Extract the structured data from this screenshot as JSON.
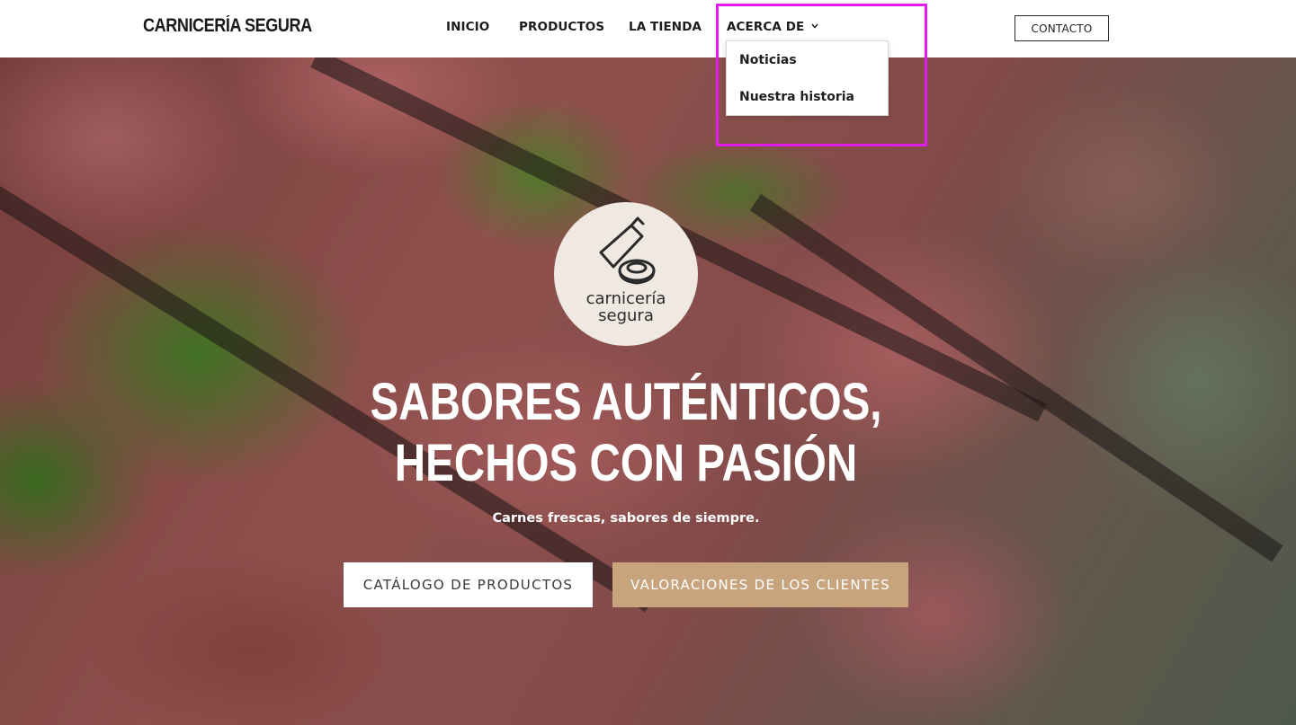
{
  "header": {
    "brand": "CARNICERÍA SEGURA",
    "nav": [
      {
        "label": "INICIO"
      },
      {
        "label": "PRODUCTOS"
      },
      {
        "label": "LA TIENDA"
      },
      {
        "label": "ACERCA DE"
      }
    ],
    "contact_label": "CONTACTO"
  },
  "dropdown": {
    "items": [
      {
        "label": "Noticias"
      },
      {
        "label": "Nuestra historia"
      }
    ]
  },
  "hero": {
    "logo_line1": "carnicería",
    "logo_line2": "segura",
    "headline_line1": "SABORES AUTÉNTICOS,",
    "headline_line2": "HECHOS CON PASIÓN",
    "subline": "Carnes frescas, sabores de siempre.",
    "button_catalog": "CATÁLOGO DE PRODUCTOS",
    "button_reviews": "VALORACIONES DE LOS CLIENTES"
  },
  "colors": {
    "accent": "#c8a47e",
    "highlight": "#e21ce8"
  },
  "icons": {
    "dropdown_chevron": "chevron-down-icon",
    "logo": "cleaver-steak-icon"
  }
}
